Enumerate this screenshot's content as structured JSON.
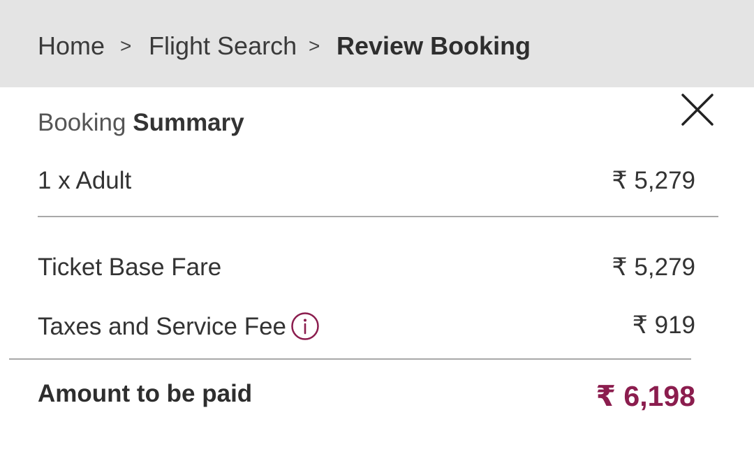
{
  "breadcrumb": {
    "items": [
      "Home",
      "Flight Search",
      "Review Booking"
    ],
    "separator": ">"
  },
  "summary": {
    "title_light": "Booking",
    "title_bold": "Summary",
    "passenger_label": "1 x Adult",
    "passenger_value": "₹ 5,279",
    "base_fare_label": "Ticket Base Fare",
    "base_fare_value": "₹ 5,279",
    "taxes_label": "Taxes and Service Fee",
    "taxes_value": "₹ 919",
    "total_label": "Amount to be paid",
    "total_value": "₹ 6,198"
  },
  "icons": {
    "close": "close-icon",
    "info": "info-icon"
  },
  "colors": {
    "accent": "#8b1d4e",
    "breadcrumb_bg": "#e4e4e4",
    "divider": "#a8a8a8"
  }
}
